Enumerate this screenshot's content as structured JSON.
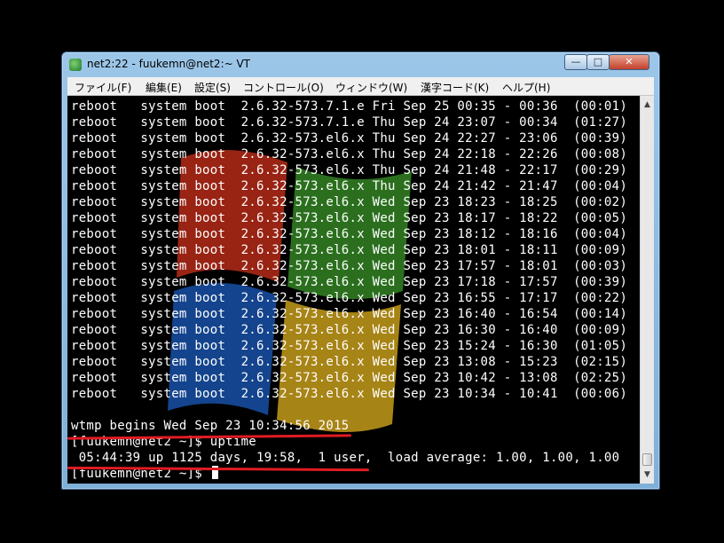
{
  "window": {
    "title": "net2:22 - fuukemn@net2:~ VT",
    "minimize_glyph": "—",
    "maximize_glyph": "□",
    "close_glyph": "✕"
  },
  "menu": [
    "ファイル(F)",
    "編集(E)",
    "設定(S)",
    "コントロール(O)",
    "ウィンドウ(W)",
    "漢字コード(K)",
    "ヘルプ(H)"
  ],
  "terminal": {
    "lines": [
      "reboot   system boot  2.6.32-573.7.1.e Fri Sep 25 00:35 - 00:36  (00:01)",
      "reboot   system boot  2.6.32-573.7.1.e Thu Sep 24 23:07 - 00:34  (01:27)",
      "reboot   system boot  2.6.32-573.el6.x Thu Sep 24 22:27 - 23:06  (00:39)",
      "reboot   system boot  2.6.32-573.el6.x Thu Sep 24 22:18 - 22:26  (00:08)",
      "reboot   system boot  2.6.32-573.el6.x Thu Sep 24 21:48 - 22:17  (00:29)",
      "reboot   system boot  2.6.32-573.el6.x Thu Sep 24 21:42 - 21:47  (00:04)",
      "reboot   system boot  2.6.32-573.el6.x Wed Sep 23 18:23 - 18:25  (00:02)",
      "reboot   system boot  2.6.32-573.el6.x Wed Sep 23 18:17 - 18:22  (00:05)",
      "reboot   system boot  2.6.32-573.el6.x Wed Sep 23 18:12 - 18:16  (00:04)",
      "reboot   system boot  2.6.32-573.el6.x Wed Sep 23 18:01 - 18:11  (00:09)",
      "reboot   system boot  2.6.32-573.el6.x Wed Sep 23 17:57 - 18:01  (00:03)",
      "reboot   system boot  2.6.32-573.el6.x Wed Sep 23 17:18 - 17:57  (00:39)",
      "reboot   system boot  2.6.32-573.el6.x Wed Sep 23 16:55 - 17:17  (00:22)",
      "reboot   system boot  2.6.32-573.el6.x Wed Sep 23 16:40 - 16:54  (00:14)",
      "reboot   system boot  2.6.32-573.el6.x Wed Sep 23 16:30 - 16:40  (00:09)",
      "reboot   system boot  2.6.32-573.el6.x Wed Sep 23 15:24 - 16:30  (01:05)",
      "reboot   system boot  2.6.32-573.el6.x Wed Sep 23 13:08 - 15:23  (02:15)",
      "reboot   system boot  2.6.32-573.el6.x Wed Sep 23 10:42 - 13:08  (02:25)",
      "reboot   system boot  2.6.32-573.el6.x Wed Sep 23 10:34 - 10:41  (00:06)"
    ],
    "wtmp_line": "wtmp begins Wed Sep 23 10:34:56 2015",
    "prompt_uptime": "[fuukemn@net2 ~]$ uptime",
    "uptime_output": " 05:44:39 up 1125 days, 19:58,  1 user,  load average: 1.00, 1.00, 1.00",
    "prompt_current": "[fuukemn@net2 ~]$ "
  },
  "scrollbar": {
    "up_glyph": "▲",
    "down_glyph": "▼"
  },
  "colors": {
    "terminal_bg": "#000000",
    "terminal_fg": "#ffffff",
    "highlight_underline": "#e01b24",
    "window_frame": "#8ab9e0"
  }
}
